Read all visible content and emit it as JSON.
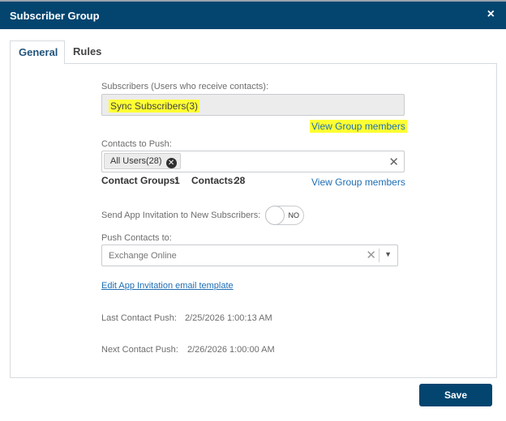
{
  "dialog": {
    "title": "Subscriber Group",
    "close_symbol": "×"
  },
  "tabs": [
    {
      "label": "General",
      "active": true
    },
    {
      "label": "Rules",
      "active": false
    }
  ],
  "general": {
    "subscribers": {
      "label": "Subscribers (Users who receive contacts):",
      "value": "Sync Subscribers(3)",
      "view_link": "View Group members"
    },
    "contacts_to_push": {
      "label": "Contacts to Push:",
      "tags": [
        {
          "label": "All Users(28)"
        }
      ],
      "contact_groups_label": "Contact Groups:",
      "contact_groups_value": "1",
      "contacts_label": "Contacts:",
      "contacts_value": "28",
      "view_link": "View Group members"
    },
    "app_invitation": {
      "label": "Send App Invitation to New Subscribers:",
      "toggle_text": "NO",
      "toggle_on": false
    },
    "push_contacts_to": {
      "label": "Push Contacts to:",
      "placeholder": "Exchange Online"
    },
    "edit_template_link": "Edit App Invitation email template",
    "last_push": {
      "label": "Last Contact Push:",
      "value": "2/25/2026 1:00:13 AM"
    },
    "next_push": {
      "label": "Next Contact Push:",
      "value": "2/26/2026 1:00:00 AM"
    }
  },
  "footer": {
    "save_label": "Save"
  },
  "colors": {
    "header_bg": "#03456f",
    "link": "#1e6eb5",
    "highlight": "#ffff33",
    "active_tab_text": "#22547c"
  },
  "icons": {
    "close": "close-icon",
    "tag_remove": "remove-circle-icon",
    "clear": "clear-x-icon",
    "dropdown": "chevron-down-icon"
  }
}
